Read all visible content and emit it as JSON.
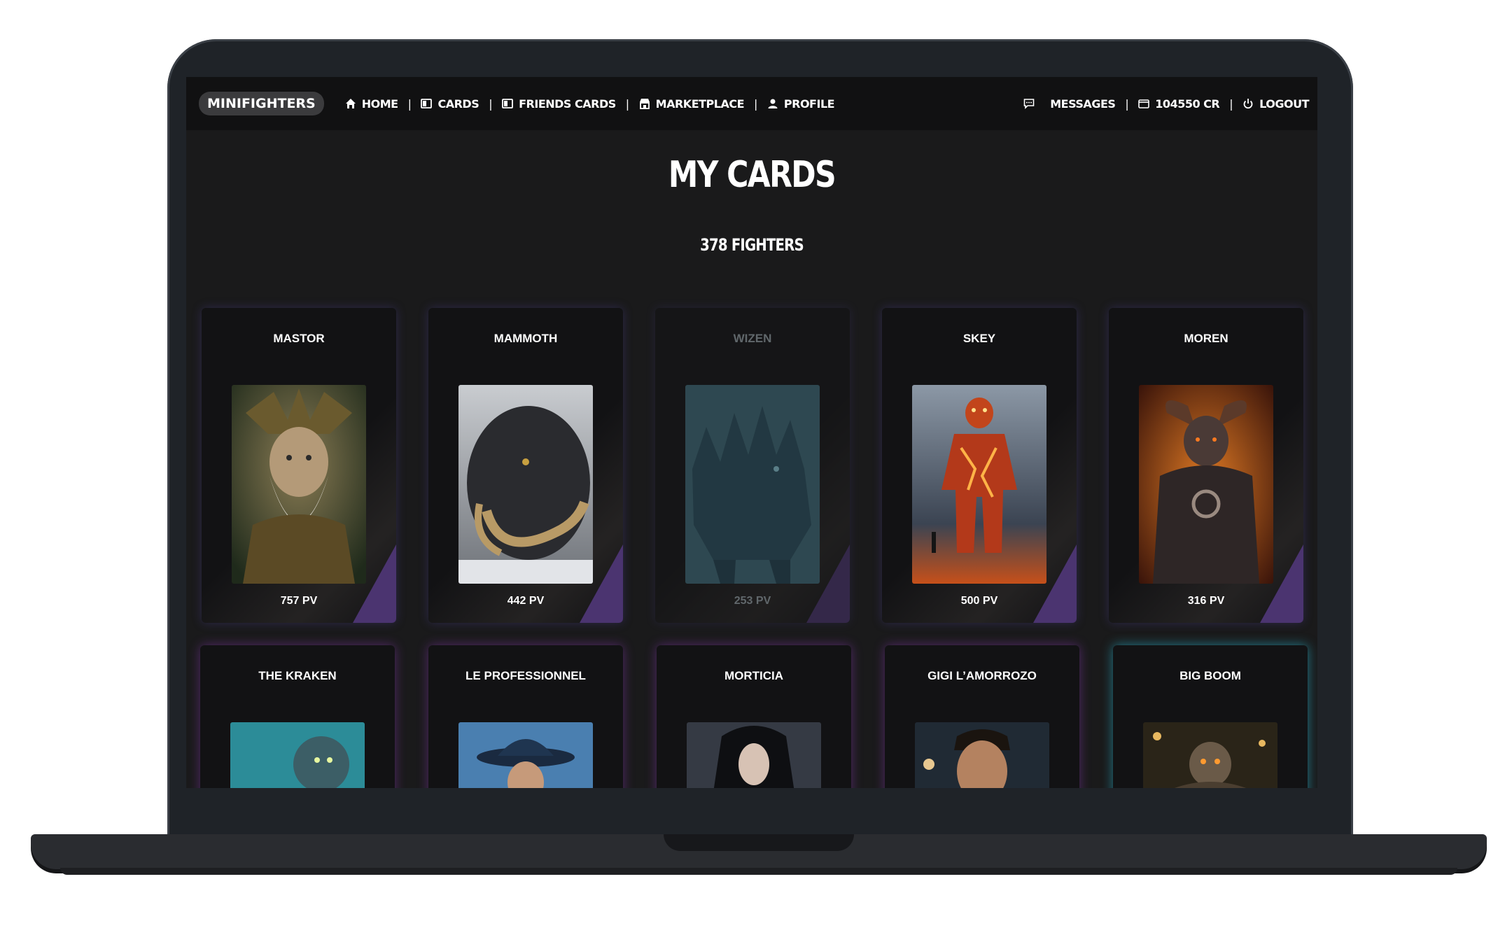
{
  "nav": {
    "brand": "MINIFIGHTERS",
    "left": [
      {
        "label": "HOME",
        "icon": "home-icon"
      },
      {
        "label": "CARDS",
        "icon": "cards-icon"
      },
      {
        "label": "FRIENDS CARDS",
        "icon": "friends-cards-icon"
      },
      {
        "label": "MARKETPLACE",
        "icon": "store-icon"
      },
      {
        "label": "PROFILE",
        "icon": "user-icon"
      }
    ],
    "right": [
      {
        "label": "MESSAGES",
        "icon": "chat-icon"
      },
      {
        "label": "104550 CR",
        "icon": "wallet-icon"
      },
      {
        "label": "LOGOUT",
        "icon": "power-icon"
      }
    ]
  },
  "page": {
    "title": "MY CARDS",
    "subtitle": "378 FIGHTERS"
  },
  "cards_row1": [
    {
      "name": "MASTOR",
      "pv": "757 PV"
    },
    {
      "name": "MAMMOTH",
      "pv": "442 PV"
    },
    {
      "name": "WIZEN",
      "pv": "253 PV"
    },
    {
      "name": "SKEY",
      "pv": "500 PV"
    },
    {
      "name": "MOREN",
      "pv": "316 PV"
    }
  ],
  "cards_row2": [
    {
      "name": "THE KRAKEN"
    },
    {
      "name": "LE PROFESSIONNEL"
    },
    {
      "name": "MORTICIA"
    },
    {
      "name": "GIGI L’AMORROZO"
    },
    {
      "name": "BIG BOOM"
    }
  ],
  "colors": {
    "accent_purple": "#4b3470",
    "glow_cyan": "#28c8e6",
    "background": "#1a1a1b",
    "navbar": "#111112"
  }
}
